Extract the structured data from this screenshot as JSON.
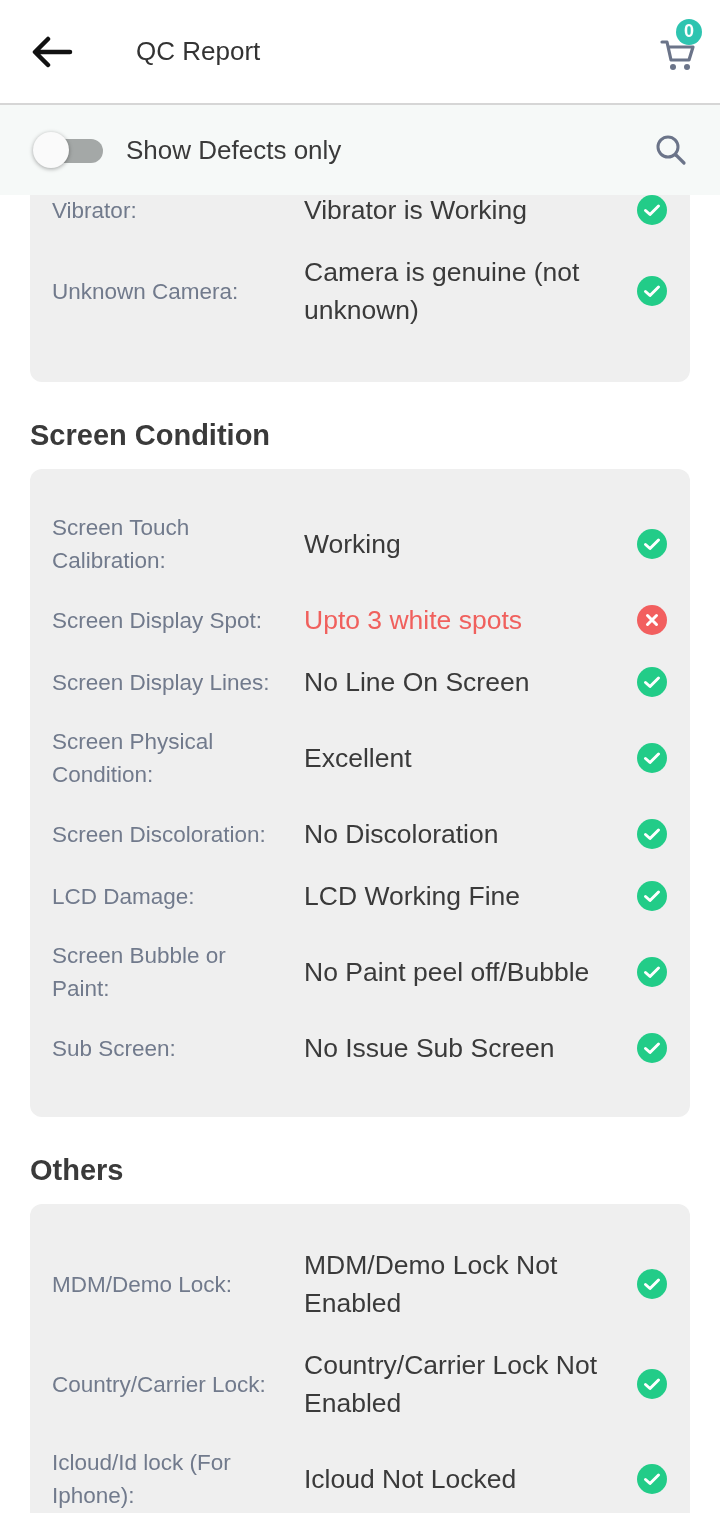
{
  "app_bar": {
    "title": "QC Report",
    "cart_count": "0"
  },
  "filter_bar": {
    "label": "Show Defects only",
    "on": false
  },
  "sections": [
    {
      "rows": [
        {
          "label": "Vibrator:",
          "value": "Vibrator is Working",
          "defect": false
        },
        {
          "label": "Unknown Camera:",
          "value": "Camera is genuine (not unknown)",
          "defect": false
        }
      ]
    },
    {
      "title": "Screen Condition",
      "rows": [
        {
          "label": "Screen Touch Calibration:",
          "value": "Working",
          "defect": false
        },
        {
          "label": "Screen Display Spot:",
          "value": "Upto 3 white spots",
          "defect": true
        },
        {
          "label": "Screen Display Lines:",
          "value": "No Line On Screen",
          "defect": false
        },
        {
          "label": "Screen Physical Condition:",
          "value": "Excellent",
          "defect": false
        },
        {
          "label": "Screen Discoloration:",
          "value": "No Discoloration",
          "defect": false
        },
        {
          "label": "LCD Damage:",
          "value": "LCD Working Fine",
          "defect": false
        },
        {
          "label": "Screen Bubble or Paint:",
          "value": "No Paint peel off/Bubble",
          "defect": false
        },
        {
          "label": "Sub Screen:",
          "value": "No Issue Sub Screen",
          "defect": false
        }
      ]
    },
    {
      "title": "Others",
      "rows": [
        {
          "label": "MDM/Demo Lock:",
          "value": "MDM/Demo Lock Not Enabled",
          "defect": false
        },
        {
          "label": "Country/Carrier Lock:",
          "value": "Country/Carrier Lock Not Enabled",
          "defect": false
        },
        {
          "label": "Icloud/Id lock (For Iphone):",
          "value": "Icloud Not Locked",
          "defect": false
        }
      ]
    }
  ]
}
